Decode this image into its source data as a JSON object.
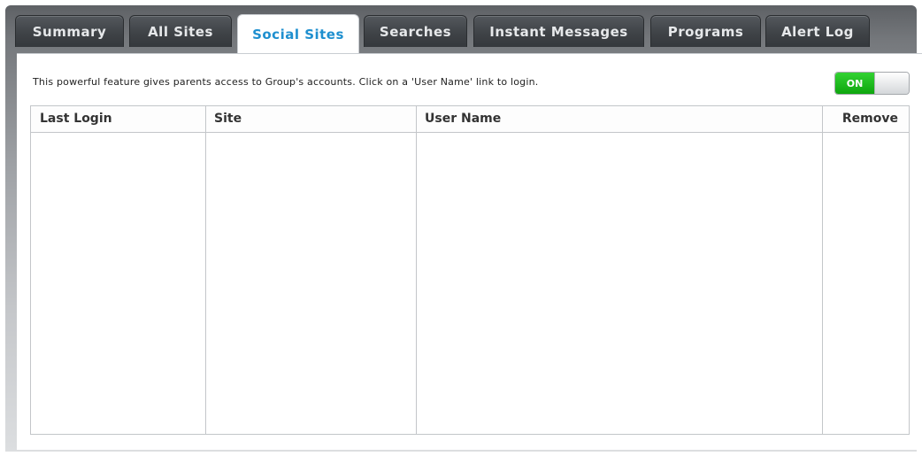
{
  "tabs": [
    {
      "label": "Summary"
    },
    {
      "label": "All Sites"
    },
    {
      "label": "Social Sites",
      "active": true
    },
    {
      "label": "Searches"
    },
    {
      "label": "Instant Messages"
    },
    {
      "label": "Programs"
    },
    {
      "label": "Alert Log"
    }
  ],
  "intro_text": "This powerful feature gives parents access to Group's accounts.  Click on a 'User Name' link to login.",
  "toggle": {
    "label": "ON",
    "state": "on",
    "color": "#1fbf1f"
  },
  "table": {
    "columns": [
      "Last Login",
      "Site",
      "User Name",
      "Remove"
    ],
    "rows": []
  },
  "colors": {
    "active_tab_text": "#1e8fcf",
    "tab_bg": "#3f4347"
  }
}
